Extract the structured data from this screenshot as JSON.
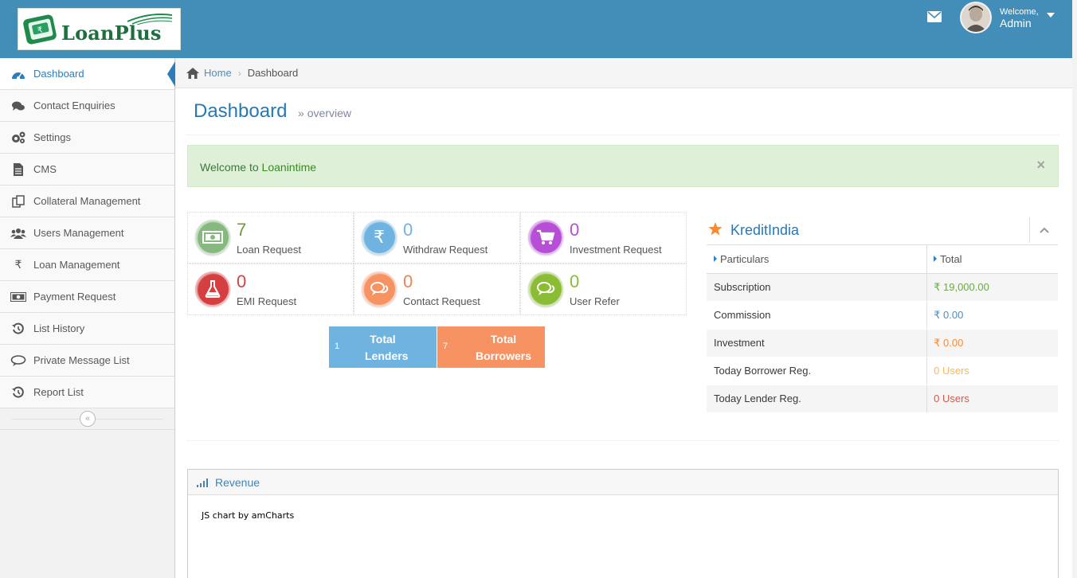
{
  "brand": {
    "name": "LoanPlus"
  },
  "header": {
    "welcome": "Welcome,",
    "user": "Admin"
  },
  "sidebar": {
    "items": [
      {
        "label": "Dashboard"
      },
      {
        "label": "Contact Enquiries"
      },
      {
        "label": "Settings"
      },
      {
        "label": "CMS"
      },
      {
        "label": "Collateral Management"
      },
      {
        "label": "Users Management"
      },
      {
        "label": "Loan Management"
      },
      {
        "label": "Payment Request"
      },
      {
        "label": "List History"
      },
      {
        "label": "Private Message List"
      },
      {
        "label": "Report List"
      }
    ]
  },
  "breadcrumb": {
    "home": "Home",
    "current": "Dashboard"
  },
  "page": {
    "title": "Dashboard",
    "subtitle": "overview"
  },
  "alert": {
    "text": "Welcome to ",
    "highlight": "Loanintime",
    "close": "×"
  },
  "infoboxes": [
    {
      "value": "7",
      "label": "Loan Request",
      "color": "#87b87f",
      "num_color": "#6f9c2f"
    },
    {
      "value": "0",
      "label": "Withdraw Request",
      "color": "#6fb3e0",
      "num_color": "#6fb3e0"
    },
    {
      "value": "0",
      "label": "Investment Request",
      "color": "#b74ed6",
      "num_color": "#b74ed6"
    },
    {
      "value": "0",
      "label": "EMI Request",
      "color": "#d53f40",
      "num_color": "#d53f40"
    },
    {
      "value": "0",
      "label": "Contact Request",
      "color": "#f79263",
      "num_color": "#e8845a"
    },
    {
      "value": "0",
      "label": "User Refer",
      "color": "#8bbc36",
      "num_color": "#8bbc36"
    }
  ],
  "totals": {
    "lenders": {
      "count": "1",
      "line1": "Total",
      "line2": "Lenders"
    },
    "borrowers": {
      "count": "7",
      "line1": "Total",
      "line2": "Borrowers"
    }
  },
  "widget": {
    "title": "KreditIndia",
    "col1": "Particulars",
    "col2": "Total",
    "rows": [
      {
        "label": "Subscription",
        "value": "₹ 19,000.00",
        "color": "#69aa46"
      },
      {
        "label": "Commission",
        "value": "₹ 0.00",
        "color": "#478fca"
      },
      {
        "label": "Investment",
        "value": "₹ 0.00",
        "color": "#ff892a"
      },
      {
        "label": "Today Borrower Reg.",
        "value": "0 Users",
        "color": "#ffb752"
      },
      {
        "label": "Today Lender Reg.",
        "value": "0 Users",
        "color": "#d15b47"
      }
    ]
  },
  "revenue": {
    "title": "Revenue",
    "credit": "JS chart by amCharts"
  }
}
